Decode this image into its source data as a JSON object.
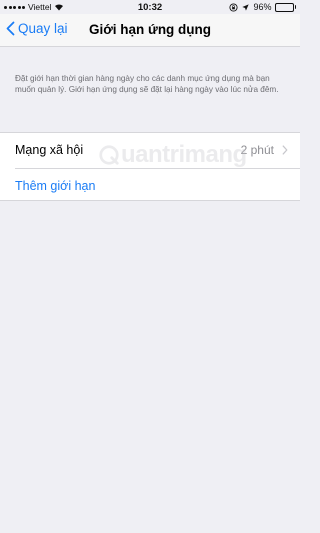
{
  "status_bar": {
    "carrier": "Viettel",
    "time": "10:32",
    "battery_percent": "96%",
    "battery_level": 0.96,
    "icons": [
      "signal-dots-icon",
      "wifi-icon",
      "rotation-lock-icon",
      "location-arrow-icon",
      "battery-icon"
    ]
  },
  "nav": {
    "back_label": "Quay lại",
    "title": "Giới hạn ứng dụng"
  },
  "description": "Đặt giới hạn thời gian hàng ngày cho các danh mục ứng dụng mà bạn muốn quản lý. Giới hạn ứng dụng sẽ đặt lại hàng ngày vào lúc nửa đêm.",
  "limits": [
    {
      "label": "Mạng xã hội",
      "value": "2 phút"
    }
  ],
  "add_limit_label": "Thêm giới hạn",
  "watermark_text": "uantrimang",
  "colors": {
    "accent": "#1a7cf5",
    "background": "#efeff4",
    "secondary_text": "#8e8e93"
  }
}
